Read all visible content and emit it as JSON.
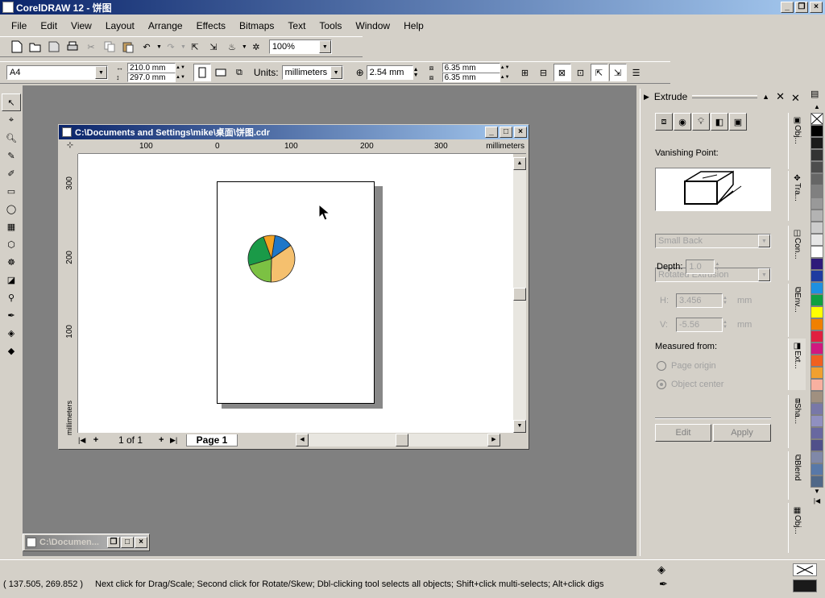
{
  "app": {
    "title": "CorelDRAW 12 - 饼图"
  },
  "menu": [
    "File",
    "Edit",
    "View",
    "Layout",
    "Arrange",
    "Effects",
    "Bitmaps",
    "Text",
    "Tools",
    "Window",
    "Help"
  ],
  "toolbar": {
    "zoom": "100%"
  },
  "property_bar": {
    "paper": "A4",
    "width": "210.0 mm",
    "height": "297.0 mm",
    "units_label": "Units:",
    "units": "millimeters",
    "nudge": "2.54 mm",
    "dup_x": "6.35 mm",
    "dup_y": "6.35 mm"
  },
  "document": {
    "title": "C:\\Documents and Settings\\mike\\桌面\\饼图.cdr",
    "ruler_unit": "millimeters",
    "h_ticks": [
      "100",
      "0",
      "100",
      "200",
      "300"
    ],
    "v_ticks": [
      "300",
      "200",
      "100"
    ],
    "page_counter": "1 of 1",
    "page_tab": "Page 1"
  },
  "pie": {
    "slices": [
      {
        "color": "#1f77c8",
        "value": 13
      },
      {
        "color": "#f5c06e",
        "value": 35
      },
      {
        "color": "#7cc143",
        "value": 20
      },
      {
        "color": "#1a9a48",
        "value": 24
      },
      {
        "color": "#f2a324",
        "value": 8
      }
    ]
  },
  "minimized": {
    "title": "C:\\Documen..."
  },
  "docker": {
    "title": "Extrude",
    "vanishing_point_label": "Vanishing Point:",
    "type": "Small Back",
    "vp_mode": "Rotated Extrusion",
    "depth_label": "Depth:",
    "depth": "1.0",
    "h_label": "H:",
    "h_value": "3.456",
    "v_label": "V:",
    "v_value": "-5.56",
    "unit": "mm",
    "measured_label": "Measured from:",
    "opt_page": "Page origin",
    "opt_object": "Object center",
    "edit": "Edit",
    "apply": "Apply"
  },
  "side_tabs": [
    "Obj...",
    "Tra...",
    "Con...",
    "Env...",
    "Ext...",
    "Sha...",
    "Blend",
    "Obj..."
  ],
  "palette": [
    "#ffffff",
    "#000000",
    "#1a1a1a",
    "#333333",
    "#4d4d4d",
    "#666666",
    "#808080",
    "#999999",
    "#b3b3b3",
    "#cccccc",
    "#e6e6e6",
    "#ffffff",
    "#2e1a7a",
    "#1e3ca0",
    "#1e90e0",
    "#10a040",
    "#ffff00",
    "#f08000",
    "#e02040",
    "#d01880",
    "#f06020",
    "#f0a030",
    "#f8b0a0",
    "#a09080",
    "#7878a8",
    "#9090c0",
    "#6868a0",
    "#50508a",
    "#8088a8",
    "#5878a8",
    "#506888"
  ],
  "status": {
    "coords": "( 137.505, 269.852 )",
    "hint": "Next click for Drag/Scale; Second click for Rotate/Skew; Dbl-clicking tool selects all objects; Shift+click multi-selects; Alt+click digs"
  }
}
